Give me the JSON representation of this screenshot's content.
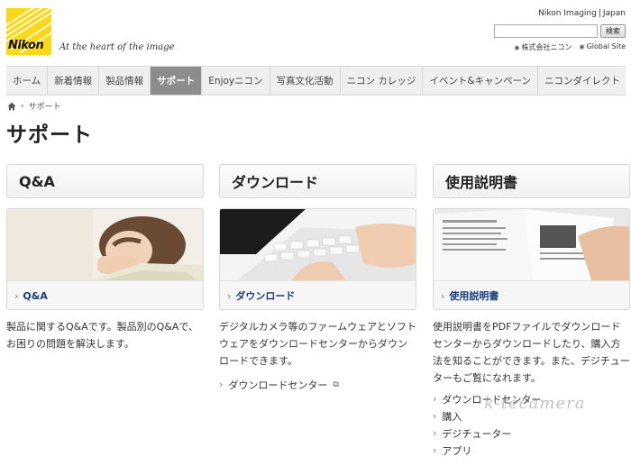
{
  "header": {
    "logo_text": "Nikon",
    "tagline": "At the heart of the image",
    "top_link": "Nikon Imaging",
    "top_region": "Japan",
    "search_button": "検索",
    "search_value": "",
    "region_links": [
      "株式会社ニコン",
      "Global Site"
    ]
  },
  "nav": {
    "items": [
      {
        "label": "ホーム"
      },
      {
        "label": "新着情報"
      },
      {
        "label": "製品情報"
      },
      {
        "label": "サポート"
      },
      {
        "label": "Enjoyニコン"
      },
      {
        "label": "写真文化活動"
      },
      {
        "label": "ニコン カレッジ"
      },
      {
        "label": "イベント&キャンペーン"
      },
      {
        "label": "ニコンダイレクト"
      }
    ],
    "active": "サポート"
  },
  "breadcrumb": {
    "current": "サポート"
  },
  "page_title": "サポート",
  "columns": [
    {
      "heading": "Q&A",
      "card_link": "Q&A",
      "description": "製品に関するQ&Aです。製品別のQ&Aで、お困りの問題を解決します。",
      "links": []
    },
    {
      "heading": "ダウンロード",
      "card_link": "ダウンロード",
      "description": "デジタルカメラ等のファームウェアとソフトウェアをダウンロードセンターからダウンロードできます。",
      "links": [
        "ダウンロードセンター"
      ]
    },
    {
      "heading": "使用説明書",
      "card_link": "使用説明書",
      "description": "使用説明書をPDFファイルでダウンロードセンターからダウンロードしたり、購入方法を知ることができます。また、デジチューターもご覧になれます。",
      "links": [
        "ダウンロードセンター",
        "購入",
        "デジチューター",
        "アプリ"
      ]
    }
  ],
  "watermark": "k-tecamera",
  "colors": {
    "logo_yellow": "#fbd91a",
    "nav_active": "#8c8c8c",
    "link_blue": "#1a3c7a"
  }
}
